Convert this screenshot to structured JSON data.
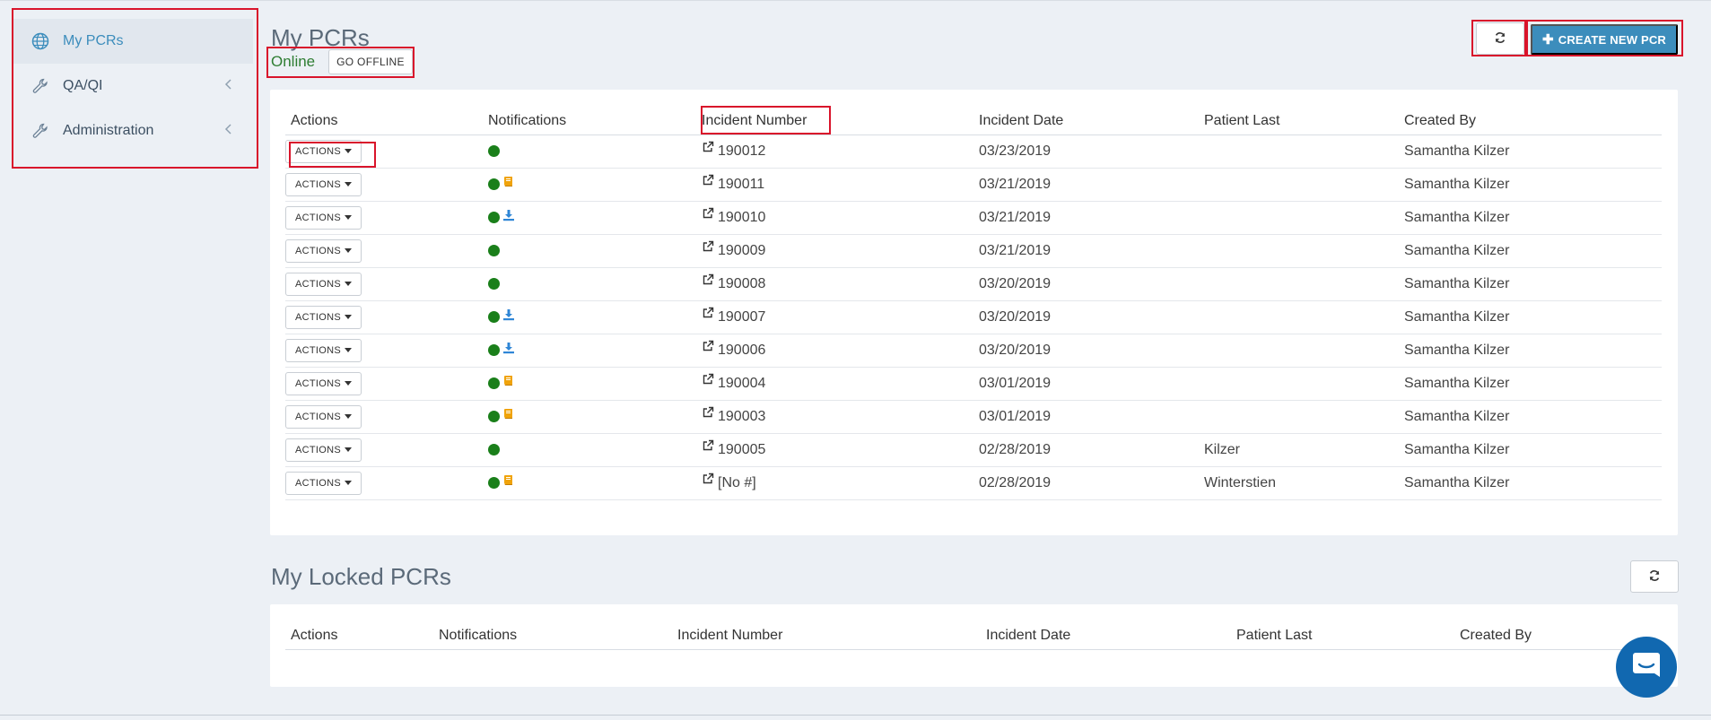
{
  "sidebar": {
    "items": [
      {
        "label": "My PCRs",
        "icon": "globe-icon",
        "active": true
      },
      {
        "label": "QA/QI",
        "icon": "wrench-icon",
        "active": false
      },
      {
        "label": "Administration",
        "icon": "wrench-icon",
        "active": false
      }
    ]
  },
  "my_pcrs": {
    "title": "My PCRs",
    "status": "Online",
    "go_offline_label": "GO OFFLINE",
    "create_label": "CREATE NEW PCR",
    "columns": [
      "Actions",
      "Notifications",
      "Incident Number",
      "Incident Date",
      "Patient Last",
      "Created By"
    ],
    "action_label": "ACTIONS",
    "rows": [
      {
        "incident": "190012",
        "date": "03/23/2019",
        "patient": "",
        "created_by": "Samantha Kilzer",
        "notif": "none"
      },
      {
        "incident": "190011",
        "date": "03/21/2019",
        "patient": "",
        "created_by": "Samantha Kilzer",
        "notif": "book-icon"
      },
      {
        "incident": "190010",
        "date": "03/21/2019",
        "patient": "",
        "created_by": "Samantha Kilzer",
        "notif": "download-icon"
      },
      {
        "incident": "190009",
        "date": "03/21/2019",
        "patient": "",
        "created_by": "Samantha Kilzer",
        "notif": "none"
      },
      {
        "incident": "190008",
        "date": "03/20/2019",
        "patient": "",
        "created_by": "Samantha Kilzer",
        "notif": "none"
      },
      {
        "incident": "190007",
        "date": "03/20/2019",
        "patient": "",
        "created_by": "Samantha Kilzer",
        "notif": "download-icon"
      },
      {
        "incident": "190006",
        "date": "03/20/2019",
        "patient": "",
        "created_by": "Samantha Kilzer",
        "notif": "download-icon"
      },
      {
        "incident": "190004",
        "date": "03/01/2019",
        "patient": "",
        "created_by": "Samantha Kilzer",
        "notif": "book-icon"
      },
      {
        "incident": "190003",
        "date": "03/01/2019",
        "patient": "",
        "created_by": "Samantha Kilzer",
        "notif": "book-icon"
      },
      {
        "incident": "190005",
        "date": "02/28/2019",
        "patient": "Kilzer",
        "created_by": "Samantha Kilzer",
        "notif": "none"
      },
      {
        "incident": "[No #]",
        "date": "02/28/2019",
        "patient": "Winterstien",
        "created_by": "Samantha Kilzer",
        "notif": "book-icon"
      }
    ]
  },
  "locked_pcrs": {
    "title": "My Locked PCRs",
    "columns": [
      "Actions",
      "Notifications",
      "Incident Number",
      "Incident Date",
      "Patient Last",
      "Created By"
    ]
  },
  "colors": {
    "accent": "#3c8dbc",
    "online": "#2e7d32",
    "status_dot": "#1a7f1a",
    "book": "#f0a30a",
    "download": "#2f86d6",
    "annotation": "#d9142b"
  }
}
